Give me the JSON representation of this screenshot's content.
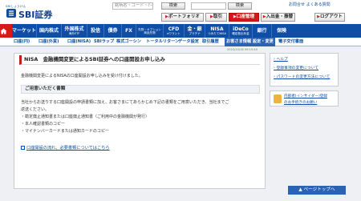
{
  "header": {
    "logo_jp": "SBIしょうけん",
    "logo_name": "SBI証券",
    "search_placeholder": "銘柄名・コード・ﾃｰﾏ",
    "search_button": "検索",
    "site_search_placeholder": "サイト内検索",
    "site_search_button": "検索",
    "top_links": "お問合せ  よくある質問",
    "buttons": {
      "portfolio": "ポートフォリオ",
      "trade": "取引",
      "account": "口座管理",
      "deposit": "入出金・振替",
      "logout": "ログアウト"
    }
  },
  "nav": [
    {
      "label": "",
      "sub": ""
    },
    {
      "label": "マーケット",
      "sub": ""
    },
    {
      "label": "国内株式",
      "sub": ""
    },
    {
      "label": "外国株式",
      "sub": "海外ETF"
    },
    {
      "label": "投信",
      "sub": ""
    },
    {
      "label": "債券",
      "sub": ""
    },
    {
      "label": "FX",
      "sub": ""
    },
    {
      "label": "先物・オプション",
      "sub": "商品先物"
    },
    {
      "label": "CFD",
      "sub": "eワラント"
    },
    {
      "label": "金・銀",
      "sub": "プラチナ"
    },
    {
      "label": "NISA",
      "sub": "つみたてNISA"
    },
    {
      "label": "iDeCo",
      "sub": "確定拠出年金"
    },
    {
      "label": "銀行",
      "sub": ""
    },
    {
      "label": "保険",
      "sub": ""
    }
  ],
  "subnav": {
    "items": [
      "口座(円)",
      "口座(外貨)",
      "口座(NISA)",
      "SBIラップ",
      "株式ゴーシン",
      "トータルリターン",
      "データ設定",
      "取引履歴",
      "お客さま情報 設定・変更",
      "電子交付書面"
    ],
    "selected_index": 8
  },
  "timestamp": "2023/10/18 09:15:40",
  "main": {
    "title": "NISA　金融機関変更によるSBI証券への口座開設お申し込み",
    "intro": "金融機関変更によるNISAの口座開設お申し込みを受け付けました。",
    "docs_heading": "ご用意いただく書類",
    "body_lines": [
      "当社からお送りする口座開設の申請書類に加え、お客さまにてあらかじめ下記の書類をご用意いただき、当社までご",
      "返送ください。",
      "・勘定廃止通知書または口座廃止通知書（ご利用中の金融機関が発行）",
      "・本人確認書類のコピー",
      "・マイナンバーカードまたは通知カードのコピー"
    ],
    "docs_link": "口座開設の流れ、必要書類についてはこちら"
  },
  "side": {
    "help": "ヘルプ",
    "links": [
      "登録事項の変更について",
      "パスワードの変更方法について"
    ]
  },
  "side2": {
    "lines": [
      "内部者(インサイダー)登録",
      "のお手続きのお願い"
    ]
  },
  "pagetop": "ページトップへ"
}
